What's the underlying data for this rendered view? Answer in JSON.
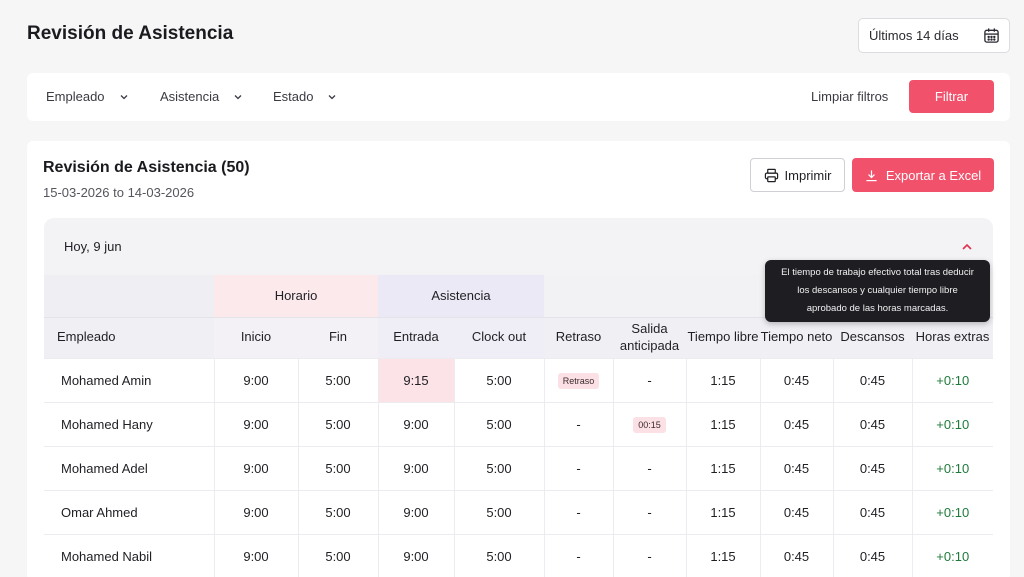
{
  "header": {
    "title": "Revisión de Asistencia",
    "date_range": "Últimos 14 días"
  },
  "filters": {
    "employee": "Empleado",
    "attendance": "Asistencia",
    "status": "Estado",
    "clear": "Limpiar filtros",
    "apply": "Filtrar"
  },
  "card": {
    "title": "Revisión de Asistencia (50)",
    "range": "15-03-2026 to 14-03-2026",
    "print": "Imprimir",
    "export": "Exportar a Excel"
  },
  "day": {
    "label": "Hoy, 9 jun"
  },
  "table": {
    "groups": {
      "schedule": "Horario",
      "attendance": "Asistencia"
    },
    "columns": [
      "Empleado",
      "Inicio",
      "Fin",
      "Entrada",
      "Clock out",
      "Retraso",
      "Salida anticipada",
      "Tiempo libre",
      "Tiempo neto",
      "Descansos",
      "Horas extras"
    ],
    "rows": [
      {
        "name": "Mohamed Amin",
        "start": "9:00",
        "end": "5:00",
        "in": "9:15",
        "out": "5:00",
        "late": "Retraso",
        "early": "-",
        "free": "1:15",
        "net": "0:45",
        "breaks": "0:45",
        "overtime": "+0:10"
      },
      {
        "name": "Mohamed Hany",
        "start": "9:00",
        "end": "5:00",
        "in": "9:00",
        "out": "5:00",
        "late": "-",
        "early": "00:15",
        "free": "1:15",
        "net": "0:45",
        "breaks": "0:45",
        "overtime": "+0:10"
      },
      {
        "name": "Mohamed Adel",
        "start": "9:00",
        "end": "5:00",
        "in": "9:00",
        "out": "5:00",
        "late": "-",
        "early": "-",
        "free": "1:15",
        "net": "0:45",
        "breaks": "0:45",
        "overtime": "+0:10"
      },
      {
        "name": "Omar Ahmed",
        "start": "9:00",
        "end": "5:00",
        "in": "9:00",
        "out": "5:00",
        "late": "-",
        "early": "-",
        "free": "1:15",
        "net": "0:45",
        "breaks": "0:45",
        "overtime": "+0:10"
      },
      {
        "name": "Mohamed Nabil",
        "start": "9:00",
        "end": "5:00",
        "in": "9:00",
        "out": "5:00",
        "late": "-",
        "early": "-",
        "free": "1:15",
        "net": "0:45",
        "breaks": "0:45",
        "overtime": "+0:10"
      }
    ]
  },
  "tooltip": {
    "line1": "El tiempo de trabajo efectivo total tras deducir",
    "line2": "los descansos y cualquier tiempo libre",
    "line3": "aprobado de las horas marcadas."
  },
  "icons": {
    "calendar": "calendar-icon",
    "chevron": "chevron-down-icon",
    "printer": "printer-icon",
    "download": "download-icon",
    "collapse": "chevron-up-icon"
  },
  "colors": {
    "accent": "#f2516b",
    "late_highlight": "#fbe3e7",
    "overtime": "#1f7a3a"
  }
}
